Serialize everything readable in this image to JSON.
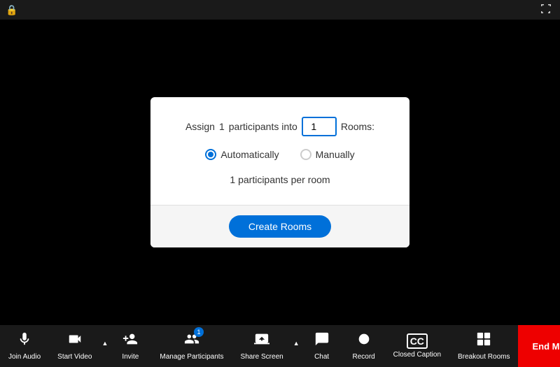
{
  "topbar": {
    "security_icon": "🔒",
    "fullscreen_icon": "⛶"
  },
  "dialog": {
    "assign_text_before": "Assign",
    "assign_participants": "1",
    "assign_text_middle": "participants into",
    "rooms_number": "1",
    "assign_text_after": "Rooms:",
    "auto_label": "Automatically",
    "manual_label": "Manually",
    "per_room_text": "1 participants per room",
    "create_rooms_label": "Create Rooms"
  },
  "toolbar": {
    "items": [
      {
        "id": "join-audio",
        "label": "Join Audio",
        "icon": "🎙"
      },
      {
        "id": "start-video",
        "label": "Start Video",
        "icon": "📷",
        "has_arrow": true
      },
      {
        "id": "invite",
        "label": "Invite",
        "icon": "👤"
      },
      {
        "id": "manage-participants",
        "label": "Manage Participants",
        "icon": "👥",
        "badge": "1"
      },
      {
        "id": "share-screen",
        "label": "Share Screen",
        "icon": "🖥",
        "has_arrow": true
      },
      {
        "id": "chat",
        "label": "Chat",
        "icon": "💬"
      },
      {
        "id": "record",
        "label": "Record",
        "icon": "⏺"
      },
      {
        "id": "closed-caption",
        "label": "Closed Caption",
        "icon": "CC"
      },
      {
        "id": "breakout-rooms",
        "label": "Breakout Rooms",
        "icon": "⊞"
      }
    ],
    "end_meeting_label": "End Meeting"
  }
}
